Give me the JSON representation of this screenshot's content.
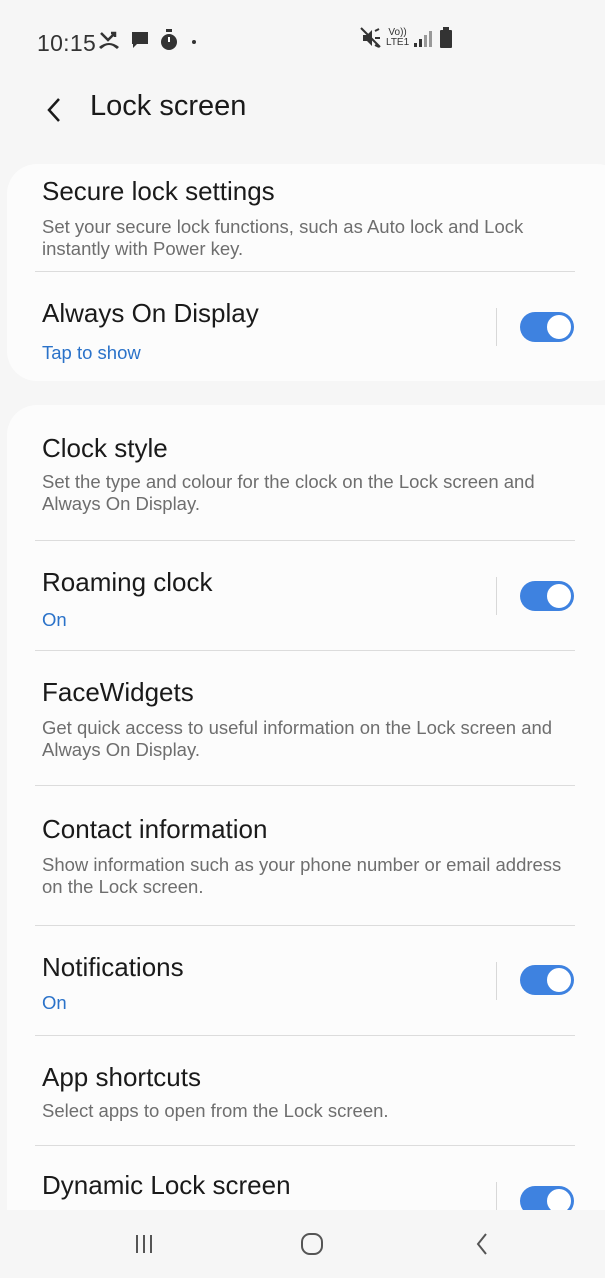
{
  "status_bar": {
    "time": "10:15",
    "left_icons": [
      "missed-call-icon",
      "message-icon",
      "timer-icon",
      "dot-icon"
    ],
    "right_icons": [
      "mute-icon",
      "volte-lte-icon",
      "signal-icon",
      "battery-icon"
    ],
    "volte_label": "Vo))",
    "lte_label": "LTE1"
  },
  "app_bar": {
    "title": "Lock screen"
  },
  "colors": {
    "accent": "#2a72c9",
    "toggle_on": "#3e82e0",
    "background": "#f6f6f6",
    "card": "#fcfcfc"
  },
  "settings": {
    "secure_lock": {
      "title": "Secure lock settings",
      "subtitle": "Set your secure lock functions, such as Auto lock and Lock instantly with Power key."
    },
    "always_on_display": {
      "title": "Always On Display",
      "subtitle": "Tap to show",
      "enabled": true
    },
    "clock_style": {
      "title": "Clock style",
      "subtitle": "Set the type and colour for the clock on the Lock screen and Always On Display."
    },
    "roaming_clock": {
      "title": "Roaming clock",
      "subtitle": "On",
      "enabled": true
    },
    "facewidgets": {
      "title": "FaceWidgets",
      "subtitle": "Get quick access to useful information on the Lock screen and Always On Display."
    },
    "contact_information": {
      "title": "Contact information",
      "subtitle": "Show information such as your phone number or email address on the Lock screen."
    },
    "notifications": {
      "title": "Notifications",
      "subtitle": "On",
      "enabled": true
    },
    "app_shortcuts": {
      "title": "App shortcuts",
      "subtitle": "Select apps to open from the Lock screen."
    },
    "dynamic_lock_screen": {
      "title": "Dynamic Lock screen",
      "enabled": true
    }
  },
  "nav_bar": {
    "buttons": [
      "recents-icon",
      "home-icon",
      "back-icon"
    ]
  }
}
